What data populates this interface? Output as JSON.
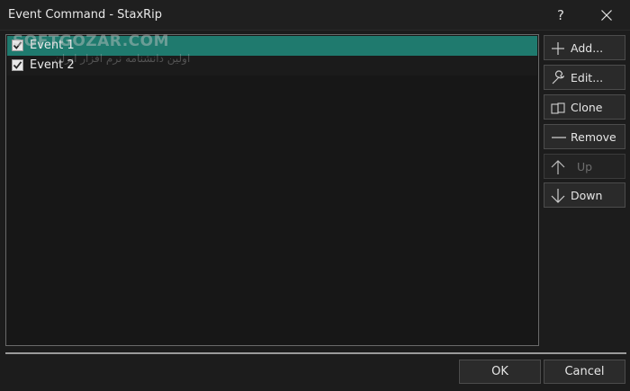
{
  "window": {
    "title": "Event Command - StaxRip",
    "help_label": "?"
  },
  "list": {
    "items": [
      {
        "label": "Event 1",
        "checked": true,
        "selected": true
      },
      {
        "label": "Event 2",
        "checked": true,
        "selected": false
      }
    ]
  },
  "watermark": {
    "text": "SOFTGOZAR.COM",
    "subtext": "اولین دانشنامه نرم افزار ایران"
  },
  "side_buttons": {
    "add": "Add...",
    "edit": "Edit...",
    "clone": "Clone",
    "remove": "Remove",
    "up": "Up",
    "down": "Down"
  },
  "footer": {
    "ok": "OK",
    "cancel": "Cancel"
  },
  "colors": {
    "selection": "#1f7a6e",
    "background": "#1c1c1c"
  }
}
